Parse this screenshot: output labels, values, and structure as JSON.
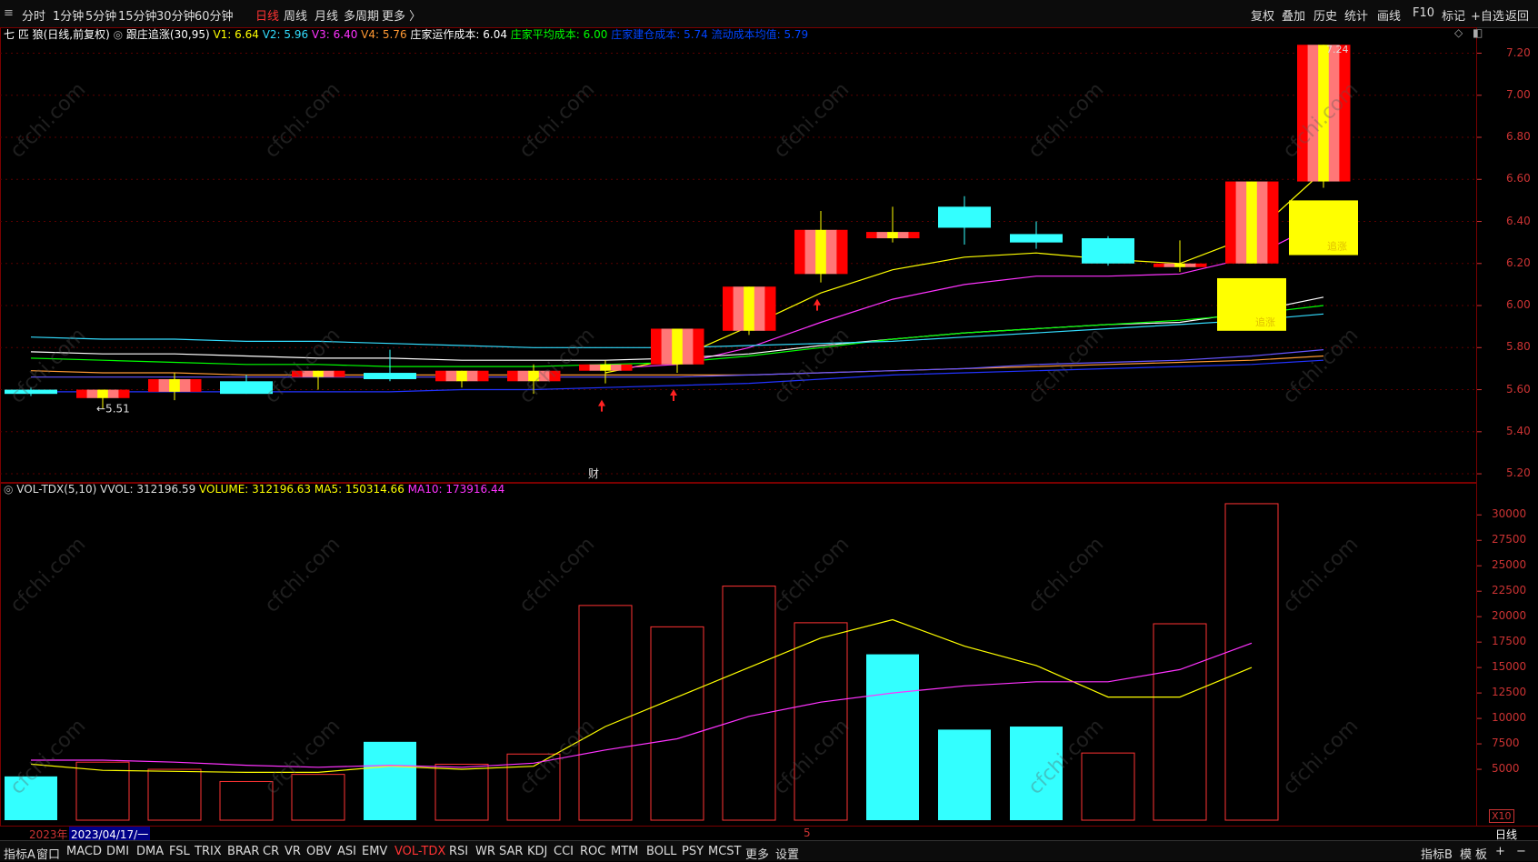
{
  "toolbar": {
    "periods": [
      "分时",
      "1分钟",
      "5分钟",
      "15分钟",
      "30分钟",
      "60分钟",
      "日线",
      "周线",
      "月线",
      "多周期",
      "更多 〉"
    ],
    "active_period": "日线",
    "right_buttons": [
      "复权",
      "叠加",
      "历史",
      "统计",
      "画线",
      "F10",
      "标记",
      "+自选",
      "返回"
    ]
  },
  "price_panel": {
    "stock_name": "七 匹 狼(日线,前复权)",
    "indicator_name": "跟庄追涨(30,95)",
    "legend": [
      {
        "text": "V1: 6.64",
        "color": "#ffff00"
      },
      {
        "text": "V2: 5.96",
        "color": "#33ddff"
      },
      {
        "text": "V3: 6.40",
        "color": "#ff33ff"
      },
      {
        "text": "V4: 5.76",
        "color": "#ff9933"
      },
      {
        "text": "庄家运作成本: 6.04",
        "color": "#ffffff"
      },
      {
        "text": "庄家平均成本: 6.00",
        "color": "#00ff00"
      },
      {
        "text": "庄家建仓成本: 5.74",
        "color": "#0044ff"
      },
      {
        "text": "流动成本均值: 5.79",
        "color": "#0044ff"
      }
    ],
    "annotations": {
      "low_label": "←5.51",
      "high_label": "7.24",
      "cai_label": "财",
      "zhuizhang_label": "追涨"
    }
  },
  "volume_panel": {
    "legend": [
      {
        "text": "VOL-TDX(5,10)",
        "color": "#dddddd"
      },
      {
        "text": "VVOL: 312196.59",
        "color": "#dddddd"
      },
      {
        "text": "VOLUME: 312196.63",
        "color": "#ffff00"
      },
      {
        "text": "MA5: 150314.66",
        "color": "#ffff00"
      },
      {
        "text": "MA10: 173916.44",
        "color": "#ff33ff"
      }
    ],
    "unit_label": "X10"
  },
  "date_bar": {
    "year_label": "2023年",
    "date_label": "2023/04/17/一",
    "month_mark": "5"
  },
  "bottom_tabs": [
    "指标A",
    "窗口",
    "MACD",
    "DMI",
    "DMA",
    "FSL",
    "TRIX",
    "BRAR",
    "CR",
    "VR",
    "OBV",
    "ASI",
    "EMV",
    "VOL-TDX",
    "RSI",
    "WR",
    "SAR",
    "KDJ",
    "CCI",
    "ROC",
    "MTM",
    "BOLL",
    "PSY",
    "MCST",
    "更多",
    "设置"
  ],
  "active_bottom_tab": "VOL-TDX",
  "bottom_right": {
    "zhibiao_b": "指标B",
    "mo": "模",
    "ban": "板",
    "plus": "+",
    "minus": "−",
    "period_right": "日线"
  },
  "watermark": "cfchi.com",
  "chart_data": [
    {
      "type": "candlestick",
      "title": "七 匹 狼(日线,前复权)",
      "y_ticks": [
        5.2,
        5.4,
        5.6,
        5.8,
        6.0,
        6.2,
        6.4,
        6.6,
        6.8,
        7.0,
        7.2
      ],
      "ylim": [
        5.17,
        7.28
      ],
      "candles": [
        {
          "open": 5.6,
          "high": 5.61,
          "low": 5.57,
          "close": 5.58,
          "color": "cyan"
        },
        {
          "open": 5.56,
          "high": 5.6,
          "low": 5.51,
          "close": 5.6,
          "color": "red"
        },
        {
          "open": 5.59,
          "high": 5.68,
          "low": 5.55,
          "close": 5.65,
          "color": "red"
        },
        {
          "open": 5.64,
          "high": 5.67,
          "low": 5.58,
          "close": 5.58,
          "color": "cyan"
        },
        {
          "open": 5.66,
          "high": 5.69,
          "low": 5.6,
          "close": 5.69,
          "color": "red"
        },
        {
          "open": 5.68,
          "high": 5.79,
          "low": 5.64,
          "close": 5.65,
          "color": "cyan"
        },
        {
          "open": 5.64,
          "high": 5.69,
          "low": 5.61,
          "close": 5.69,
          "color": "red"
        },
        {
          "open": 5.64,
          "high": 5.72,
          "low": 5.58,
          "close": 5.69,
          "color": "red"
        },
        {
          "open": 5.69,
          "high": 5.74,
          "low": 5.63,
          "close": 5.72,
          "color": "red"
        },
        {
          "open": 5.72,
          "high": 5.8,
          "low": 5.68,
          "close": 5.89,
          "color": "red"
        },
        {
          "open": 5.88,
          "high": 6.05,
          "low": 5.86,
          "close": 6.09,
          "color": "red"
        },
        {
          "open": 6.15,
          "high": 6.45,
          "low": 6.11,
          "close": 6.36,
          "color": "red"
        },
        {
          "open": 6.35,
          "high": 6.47,
          "low": 6.3,
          "close": 6.32,
          "color": "red"
        },
        {
          "open": 6.47,
          "high": 6.52,
          "low": 6.29,
          "close": 6.37,
          "color": "cyan"
        },
        {
          "open": 6.34,
          "high": 6.4,
          "low": 6.27,
          "close": 6.3,
          "color": "cyan"
        },
        {
          "open": 6.32,
          "high": 6.33,
          "low": 6.19,
          "close": 6.2,
          "color": "cyan"
        },
        {
          "open": 6.2,
          "high": 6.31,
          "low": 6.16,
          "close": 6.2,
          "color": "red"
        },
        {
          "open": 6.2,
          "high": 6.59,
          "low": 6.2,
          "close": 6.59,
          "color": "red"
        },
        {
          "open": 6.59,
          "high": 7.24,
          "low": 6.56,
          "close": 7.24,
          "color": "red"
        }
      ],
      "series": [
        {
          "name": "V1",
          "color": "#ffff00",
          "values": [
            null,
            null,
            null,
            null,
            null,
            null,
            null,
            null,
            5.68,
            5.75,
            5.9,
            6.06,
            6.17,
            6.23,
            6.25,
            6.22,
            6.2,
            6.33,
            6.64
          ]
        },
        {
          "name": "V3",
          "color": "#ff33ff",
          "values": [
            null,
            null,
            null,
            null,
            null,
            null,
            null,
            null,
            5.7,
            5.72,
            5.8,
            5.92,
            6.03,
            6.1,
            6.14,
            6.14,
            6.15,
            6.23,
            6.4
          ]
        },
        {
          "name": "庄家运作成本",
          "color": "#ffffff",
          "values": [
            5.78,
            5.77,
            5.77,
            5.76,
            5.75,
            5.75,
            5.74,
            5.74,
            5.74,
            5.75,
            5.77,
            5.81,
            5.84,
            5.87,
            5.89,
            5.91,
            5.92,
            5.97,
            6.04
          ]
        },
        {
          "name": "庄家平均成本",
          "color": "#00ff00",
          "values": [
            5.75,
            5.74,
            5.73,
            5.72,
            5.72,
            5.71,
            5.71,
            5.71,
            5.72,
            5.73,
            5.76,
            5.8,
            5.84,
            5.87,
            5.89,
            5.91,
            5.93,
            5.96,
            6.0
          ]
        },
        {
          "name": "V2",
          "color": "#33ddff",
          "values": [
            5.85,
            5.84,
            5.84,
            5.83,
            5.83,
            5.82,
            5.81,
            5.8,
            5.8,
            5.8,
            5.81,
            5.82,
            5.83,
            5.85,
            5.87,
            5.89,
            5.91,
            5.93,
            5.96
          ]
        },
        {
          "name": "V4",
          "color": "#ff9933",
          "values": [
            5.69,
            5.68,
            5.68,
            5.67,
            5.67,
            5.67,
            5.67,
            5.67,
            5.67,
            5.67,
            5.67,
            5.68,
            5.69,
            5.7,
            5.71,
            5.72,
            5.73,
            5.74,
            5.76
          ]
        },
        {
          "name": "庄家建仓成本",
          "color": "#2233ff",
          "values": [
            5.59,
            5.59,
            5.59,
            5.59,
            5.59,
            5.59,
            5.6,
            5.6,
            5.61,
            5.62,
            5.63,
            5.65,
            5.67,
            5.68,
            5.69,
            5.7,
            5.71,
            5.72,
            5.74
          ]
        },
        {
          "name": "流动成本均值",
          "color": "#6655ff",
          "values": [
            5.66,
            5.66,
            5.66,
            5.66,
            5.66,
            5.66,
            5.66,
            5.66,
            5.66,
            5.66,
            5.67,
            5.68,
            5.69,
            5.7,
            5.72,
            5.73,
            5.74,
            5.76,
            5.79
          ]
        }
      ],
      "signal_arrows": [
        8,
        9,
        11
      ],
      "signal_blocks": [
        {
          "index": 17,
          "top": 6.13,
          "bottom": 5.88,
          "label": "追涨"
        },
        {
          "index": 18,
          "top": 6.5,
          "bottom": 6.24,
          "label": "追涨"
        }
      ]
    },
    {
      "type": "bar",
      "title": "VOL-TDX(5,10)",
      "y_ticks": [
        5000,
        7500,
        10000,
        12500,
        15000,
        17500,
        20000,
        22500,
        25000,
        27500,
        30000
      ],
      "unit": "X10",
      "ylim": [
        0,
        31900
      ],
      "values": [
        4300,
        5700,
        5000,
        3800,
        4500,
        7700,
        5500,
        6500,
        21100,
        19000,
        23000,
        19400,
        16300,
        8900,
        9200,
        6600,
        19300,
        31100
      ],
      "colors": [
        "cyan",
        "red",
        "red",
        "red",
        "red",
        "cyan",
        "red",
        "red",
        "red",
        "red",
        "red",
        "red",
        "cyan",
        "cyan",
        "cyan",
        "red",
        "red",
        "red"
      ],
      "series": [
        {
          "name": "MA5",
          "color": "#ffff00",
          "values": [
            5500,
            4900,
            4800,
            4700,
            4700,
            5300,
            5000,
            5300,
            9200,
            12100,
            15000,
            17900,
            19700,
            17100,
            15200,
            12100,
            12100,
            15000
          ]
        },
        {
          "name": "MA10",
          "color": "#ff33ff",
          "values": [
            5900,
            5900,
            5700,
            5400,
            5200,
            5400,
            5200,
            5600,
            6900,
            8000,
            10200,
            11600,
            12500,
            13200,
            13600,
            13600,
            14800,
            17400
          ]
        }
      ]
    }
  ]
}
